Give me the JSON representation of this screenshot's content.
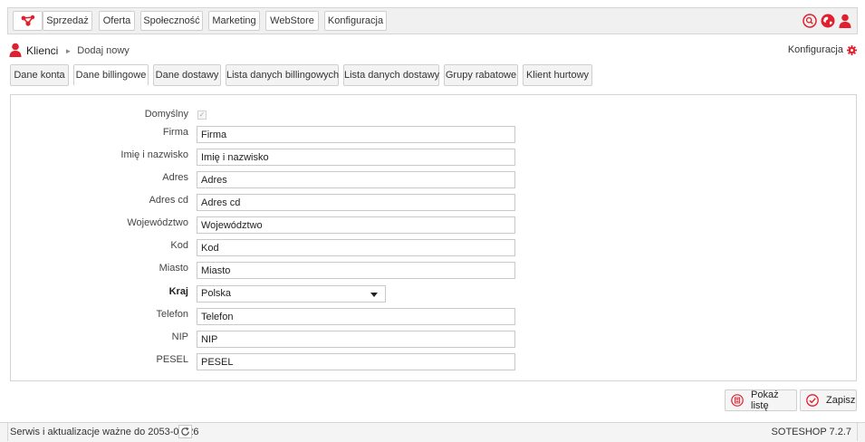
{
  "colors": {
    "accent": "#e0202e",
    "bar_bg": "#f0f0f0",
    "border": "#cfcfcf"
  },
  "topnav": {
    "logo_icon": "network-logo-icon",
    "items": [
      "Sprzedaż",
      "Oferta",
      "Społeczność",
      "Marketing",
      "WebStore",
      "Konfiguracja"
    ],
    "right_icons": [
      "search-icon",
      "globe-icon",
      "user-icon"
    ]
  },
  "breadcrumb": {
    "icon": "user-icon",
    "main": "Klienci",
    "separator": "►",
    "current": "Dodaj nowy"
  },
  "config_link": {
    "label": "Konfiguracja",
    "icon": "gear-icon"
  },
  "tabs": [
    {
      "label": "Dane konta",
      "active": false
    },
    {
      "label": "Dane billingowe",
      "active": true
    },
    {
      "label": "Dane dostawy",
      "active": false
    },
    {
      "label": "Lista danych billingowych",
      "active": false
    },
    {
      "label": "Lista danych dostawy",
      "active": false
    },
    {
      "label": "Grupy rabatowe",
      "active": false
    },
    {
      "label": "Klient hurtowy",
      "active": false
    }
  ],
  "form": {
    "default_label": "Domyślny",
    "default_checked": true,
    "fields": [
      {
        "label": "Firma",
        "placeholder": "Firma"
      },
      {
        "label": "Imię i nazwisko",
        "placeholder": "Imię i nazwisko"
      },
      {
        "label": "Adres",
        "placeholder": "Adres"
      },
      {
        "label": "Adres cd",
        "placeholder": "Adres cd"
      },
      {
        "label": "Województwo",
        "placeholder": "Województwo"
      },
      {
        "label": "Kod",
        "placeholder": "Kod"
      },
      {
        "label": "Miasto",
        "placeholder": "Miasto"
      }
    ],
    "country": {
      "label": "Kraj",
      "value": "Polska"
    },
    "fields2": [
      {
        "label": "Telefon",
        "placeholder": "Telefon"
      },
      {
        "label": "NIP",
        "placeholder": "NIP"
      },
      {
        "label": "PESEL",
        "placeholder": "PESEL"
      }
    ]
  },
  "actions": {
    "show_list": {
      "label": "Pokaż listę",
      "icon": "list-icon"
    },
    "save": {
      "label": "Zapisz",
      "icon": "check-circle-icon"
    }
  },
  "footer": {
    "service_text": "Serwis i aktualizacje ważne do 2053-08-26",
    "refresh_icon": "refresh-icon",
    "version": "SOTESHOP 7.2.7"
  }
}
